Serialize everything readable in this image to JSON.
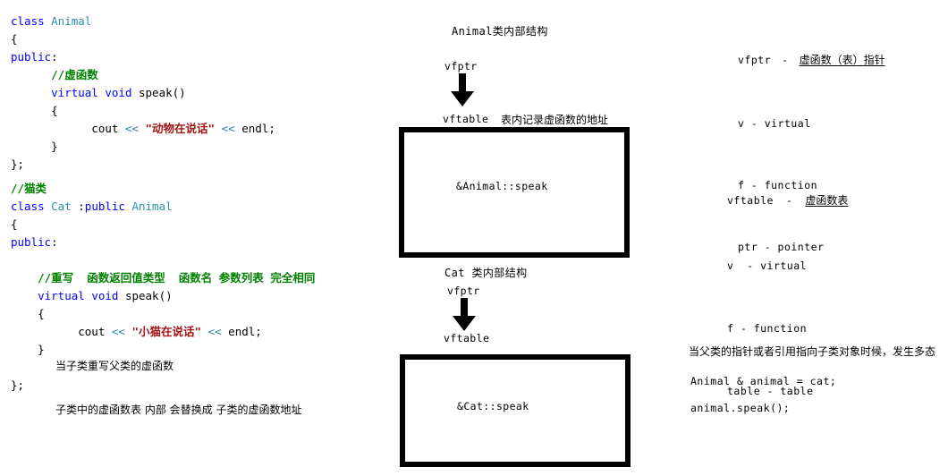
{
  "left_code": {
    "animal_class": [
      [
        {
          "t": "class ",
          "c": "kw"
        },
        {
          "t": "Animal",
          "c": "type"
        }
      ],
      [
        {
          "t": "{",
          "c": "plain"
        }
      ],
      [
        {
          "t": "public",
          "c": "kw"
        },
        {
          "t": ":",
          "c": "plain"
        }
      ],
      [
        {
          "t": "      ",
          "c": "plain"
        },
        {
          "t": "//虚函数",
          "c": "cmt"
        }
      ],
      [
        {
          "t": "      ",
          "c": "plain"
        },
        {
          "t": "virtual void ",
          "c": "kw"
        },
        {
          "t": "speak()",
          "c": "plain"
        }
      ],
      [
        {
          "t": "      {",
          "c": "plain"
        }
      ],
      [
        {
          "t": "            cout ",
          "c": "plain"
        },
        {
          "t": "<<",
          "c": "op"
        },
        {
          "t": " ",
          "c": "plain"
        },
        {
          "t": "\"动物在说话\"",
          "c": "str"
        },
        {
          "t": " ",
          "c": "plain"
        },
        {
          "t": "<<",
          "c": "op"
        },
        {
          "t": " endl;",
          "c": "plain"
        }
      ],
      [
        {
          "t": "      }",
          "c": "plain"
        }
      ],
      [
        {
          "t": "};",
          "c": "plain"
        }
      ]
    ],
    "cat_class": [
      [
        {
          "t": "//猫类",
          "c": "cmt"
        }
      ],
      [
        {
          "t": "class ",
          "c": "kw"
        },
        {
          "t": "Cat",
          "c": "type"
        },
        {
          "t": " :",
          "c": "plain"
        },
        {
          "t": "public",
          "c": "kw"
        },
        {
          "t": " ",
          "c": "plain"
        },
        {
          "t": "Animal",
          "c": "type"
        }
      ],
      [
        {
          "t": "{",
          "c": "plain"
        }
      ],
      [
        {
          "t": "public",
          "c": "kw"
        },
        {
          "t": ":",
          "c": "plain"
        }
      ],
      [
        {
          "t": "",
          "c": "plain"
        }
      ],
      [
        {
          "t": "    ",
          "c": "plain"
        },
        {
          "t": "//重写  函数返回值类型  函数名 参数列表 完全相同",
          "c": "cmt"
        }
      ],
      [
        {
          "t": "    ",
          "c": "plain"
        },
        {
          "t": "virtual void ",
          "c": "kw"
        },
        {
          "t": "speak()",
          "c": "plain"
        }
      ],
      [
        {
          "t": "    {",
          "c": "plain"
        }
      ],
      [
        {
          "t": "          cout ",
          "c": "plain"
        },
        {
          "t": "<<",
          "c": "op"
        },
        {
          "t": " ",
          "c": "plain"
        },
        {
          "t": "\"小猫在说话\"",
          "c": "str"
        },
        {
          "t": " ",
          "c": "plain"
        },
        {
          "t": "<<",
          "c": "op"
        },
        {
          "t": " endl;",
          "c": "plain"
        }
      ],
      [
        {
          "t": "    }",
          "c": "plain"
        }
      ],
      [
        {
          "t": "",
          "c": "plain"
        }
      ],
      [
        {
          "t": "};",
          "c": "plain"
        }
      ]
    ],
    "note_1": "当子类重写父类的虚函数",
    "note_2": "子类中的虚函数表 内部 会替换成 子类的虚函数地址"
  },
  "diagram": {
    "animal": {
      "title": "Animal类内部结构",
      "vfptr_label": "vfptr",
      "vftable_label": "vftable",
      "vftable_note": "表内记录虚函数的地址",
      "arrow_icon": "down-arrow-icon",
      "entries": [
        "&Animal::speak"
      ]
    },
    "cat": {
      "title": "Cat 类内部结构",
      "vfptr_label": "vfptr",
      "vftable_label": "vftable",
      "arrow_icon": "down-arrow-icon",
      "entries": [
        "&Cat::speak"
      ]
    }
  },
  "legend": {
    "vfptr": {
      "term": "vfptr",
      "dash": "-",
      "meaning": "虚函数（表）指针",
      "lines": [
        "v - virtual",
        "f - function",
        "ptr - pointer"
      ]
    },
    "vftable": {
      "term": "vftable",
      "dash": "-",
      "meaning": "虚函数表",
      "lines": [
        "v  - virtual",
        "f - function",
        "table - table"
      ]
    }
  },
  "polymorphism": {
    "note": "当父类的指针或者引用指向子类对象时候，发生多态",
    "code_lines": [
      "Animal & animal = cat;",
      "animal.speak();"
    ]
  }
}
